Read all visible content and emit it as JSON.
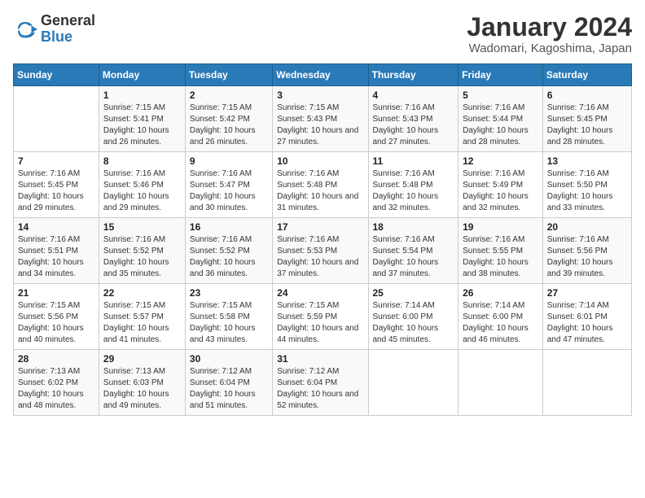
{
  "header": {
    "logo": {
      "general": "General",
      "blue": "Blue"
    },
    "title": "January 2024",
    "subtitle": "Wadomari, Kagoshima, Japan"
  },
  "calendar": {
    "days_of_week": [
      "Sunday",
      "Monday",
      "Tuesday",
      "Wednesday",
      "Thursday",
      "Friday",
      "Saturday"
    ],
    "weeks": [
      [
        {
          "day": "",
          "sunrise": "",
          "sunset": "",
          "daylight": ""
        },
        {
          "day": "1",
          "sunrise": "Sunrise: 7:15 AM",
          "sunset": "Sunset: 5:41 PM",
          "daylight": "Daylight: 10 hours and 26 minutes."
        },
        {
          "day": "2",
          "sunrise": "Sunrise: 7:15 AM",
          "sunset": "Sunset: 5:42 PM",
          "daylight": "Daylight: 10 hours and 26 minutes."
        },
        {
          "day": "3",
          "sunrise": "Sunrise: 7:15 AM",
          "sunset": "Sunset: 5:43 PM",
          "daylight": "Daylight: 10 hours and 27 minutes."
        },
        {
          "day": "4",
          "sunrise": "Sunrise: 7:16 AM",
          "sunset": "Sunset: 5:43 PM",
          "daylight": "Daylight: 10 hours and 27 minutes."
        },
        {
          "day": "5",
          "sunrise": "Sunrise: 7:16 AM",
          "sunset": "Sunset: 5:44 PM",
          "daylight": "Daylight: 10 hours and 28 minutes."
        },
        {
          "day": "6",
          "sunrise": "Sunrise: 7:16 AM",
          "sunset": "Sunset: 5:45 PM",
          "daylight": "Daylight: 10 hours and 28 minutes."
        }
      ],
      [
        {
          "day": "7",
          "sunrise": "Sunrise: 7:16 AM",
          "sunset": "Sunset: 5:45 PM",
          "daylight": "Daylight: 10 hours and 29 minutes."
        },
        {
          "day": "8",
          "sunrise": "Sunrise: 7:16 AM",
          "sunset": "Sunset: 5:46 PM",
          "daylight": "Daylight: 10 hours and 29 minutes."
        },
        {
          "day": "9",
          "sunrise": "Sunrise: 7:16 AM",
          "sunset": "Sunset: 5:47 PM",
          "daylight": "Daylight: 10 hours and 30 minutes."
        },
        {
          "day": "10",
          "sunrise": "Sunrise: 7:16 AM",
          "sunset": "Sunset: 5:48 PM",
          "daylight": "Daylight: 10 hours and 31 minutes."
        },
        {
          "day": "11",
          "sunrise": "Sunrise: 7:16 AM",
          "sunset": "Sunset: 5:48 PM",
          "daylight": "Daylight: 10 hours and 32 minutes."
        },
        {
          "day": "12",
          "sunrise": "Sunrise: 7:16 AM",
          "sunset": "Sunset: 5:49 PM",
          "daylight": "Daylight: 10 hours and 32 minutes."
        },
        {
          "day": "13",
          "sunrise": "Sunrise: 7:16 AM",
          "sunset": "Sunset: 5:50 PM",
          "daylight": "Daylight: 10 hours and 33 minutes."
        }
      ],
      [
        {
          "day": "14",
          "sunrise": "Sunrise: 7:16 AM",
          "sunset": "Sunset: 5:51 PM",
          "daylight": "Daylight: 10 hours and 34 minutes."
        },
        {
          "day": "15",
          "sunrise": "Sunrise: 7:16 AM",
          "sunset": "Sunset: 5:52 PM",
          "daylight": "Daylight: 10 hours and 35 minutes."
        },
        {
          "day": "16",
          "sunrise": "Sunrise: 7:16 AM",
          "sunset": "Sunset: 5:52 PM",
          "daylight": "Daylight: 10 hours and 36 minutes."
        },
        {
          "day": "17",
          "sunrise": "Sunrise: 7:16 AM",
          "sunset": "Sunset: 5:53 PM",
          "daylight": "Daylight: 10 hours and 37 minutes."
        },
        {
          "day": "18",
          "sunrise": "Sunrise: 7:16 AM",
          "sunset": "Sunset: 5:54 PM",
          "daylight": "Daylight: 10 hours and 37 minutes."
        },
        {
          "day": "19",
          "sunrise": "Sunrise: 7:16 AM",
          "sunset": "Sunset: 5:55 PM",
          "daylight": "Daylight: 10 hours and 38 minutes."
        },
        {
          "day": "20",
          "sunrise": "Sunrise: 7:16 AM",
          "sunset": "Sunset: 5:56 PM",
          "daylight": "Daylight: 10 hours and 39 minutes."
        }
      ],
      [
        {
          "day": "21",
          "sunrise": "Sunrise: 7:15 AM",
          "sunset": "Sunset: 5:56 PM",
          "daylight": "Daylight: 10 hours and 40 minutes."
        },
        {
          "day": "22",
          "sunrise": "Sunrise: 7:15 AM",
          "sunset": "Sunset: 5:57 PM",
          "daylight": "Daylight: 10 hours and 41 minutes."
        },
        {
          "day": "23",
          "sunrise": "Sunrise: 7:15 AM",
          "sunset": "Sunset: 5:58 PM",
          "daylight": "Daylight: 10 hours and 43 minutes."
        },
        {
          "day": "24",
          "sunrise": "Sunrise: 7:15 AM",
          "sunset": "Sunset: 5:59 PM",
          "daylight": "Daylight: 10 hours and 44 minutes."
        },
        {
          "day": "25",
          "sunrise": "Sunrise: 7:14 AM",
          "sunset": "Sunset: 6:00 PM",
          "daylight": "Daylight: 10 hours and 45 minutes."
        },
        {
          "day": "26",
          "sunrise": "Sunrise: 7:14 AM",
          "sunset": "Sunset: 6:00 PM",
          "daylight": "Daylight: 10 hours and 46 minutes."
        },
        {
          "day": "27",
          "sunrise": "Sunrise: 7:14 AM",
          "sunset": "Sunset: 6:01 PM",
          "daylight": "Daylight: 10 hours and 47 minutes."
        }
      ],
      [
        {
          "day": "28",
          "sunrise": "Sunrise: 7:13 AM",
          "sunset": "Sunset: 6:02 PM",
          "daylight": "Daylight: 10 hours and 48 minutes."
        },
        {
          "day": "29",
          "sunrise": "Sunrise: 7:13 AM",
          "sunset": "Sunset: 6:03 PM",
          "daylight": "Daylight: 10 hours and 49 minutes."
        },
        {
          "day": "30",
          "sunrise": "Sunrise: 7:12 AM",
          "sunset": "Sunset: 6:04 PM",
          "daylight": "Daylight: 10 hours and 51 minutes."
        },
        {
          "day": "31",
          "sunrise": "Sunrise: 7:12 AM",
          "sunset": "Sunset: 6:04 PM",
          "daylight": "Daylight: 10 hours and 52 minutes."
        },
        {
          "day": "",
          "sunrise": "",
          "sunset": "",
          "daylight": ""
        },
        {
          "day": "",
          "sunrise": "",
          "sunset": "",
          "daylight": ""
        },
        {
          "day": "",
          "sunrise": "",
          "sunset": "",
          "daylight": ""
        }
      ]
    ]
  }
}
